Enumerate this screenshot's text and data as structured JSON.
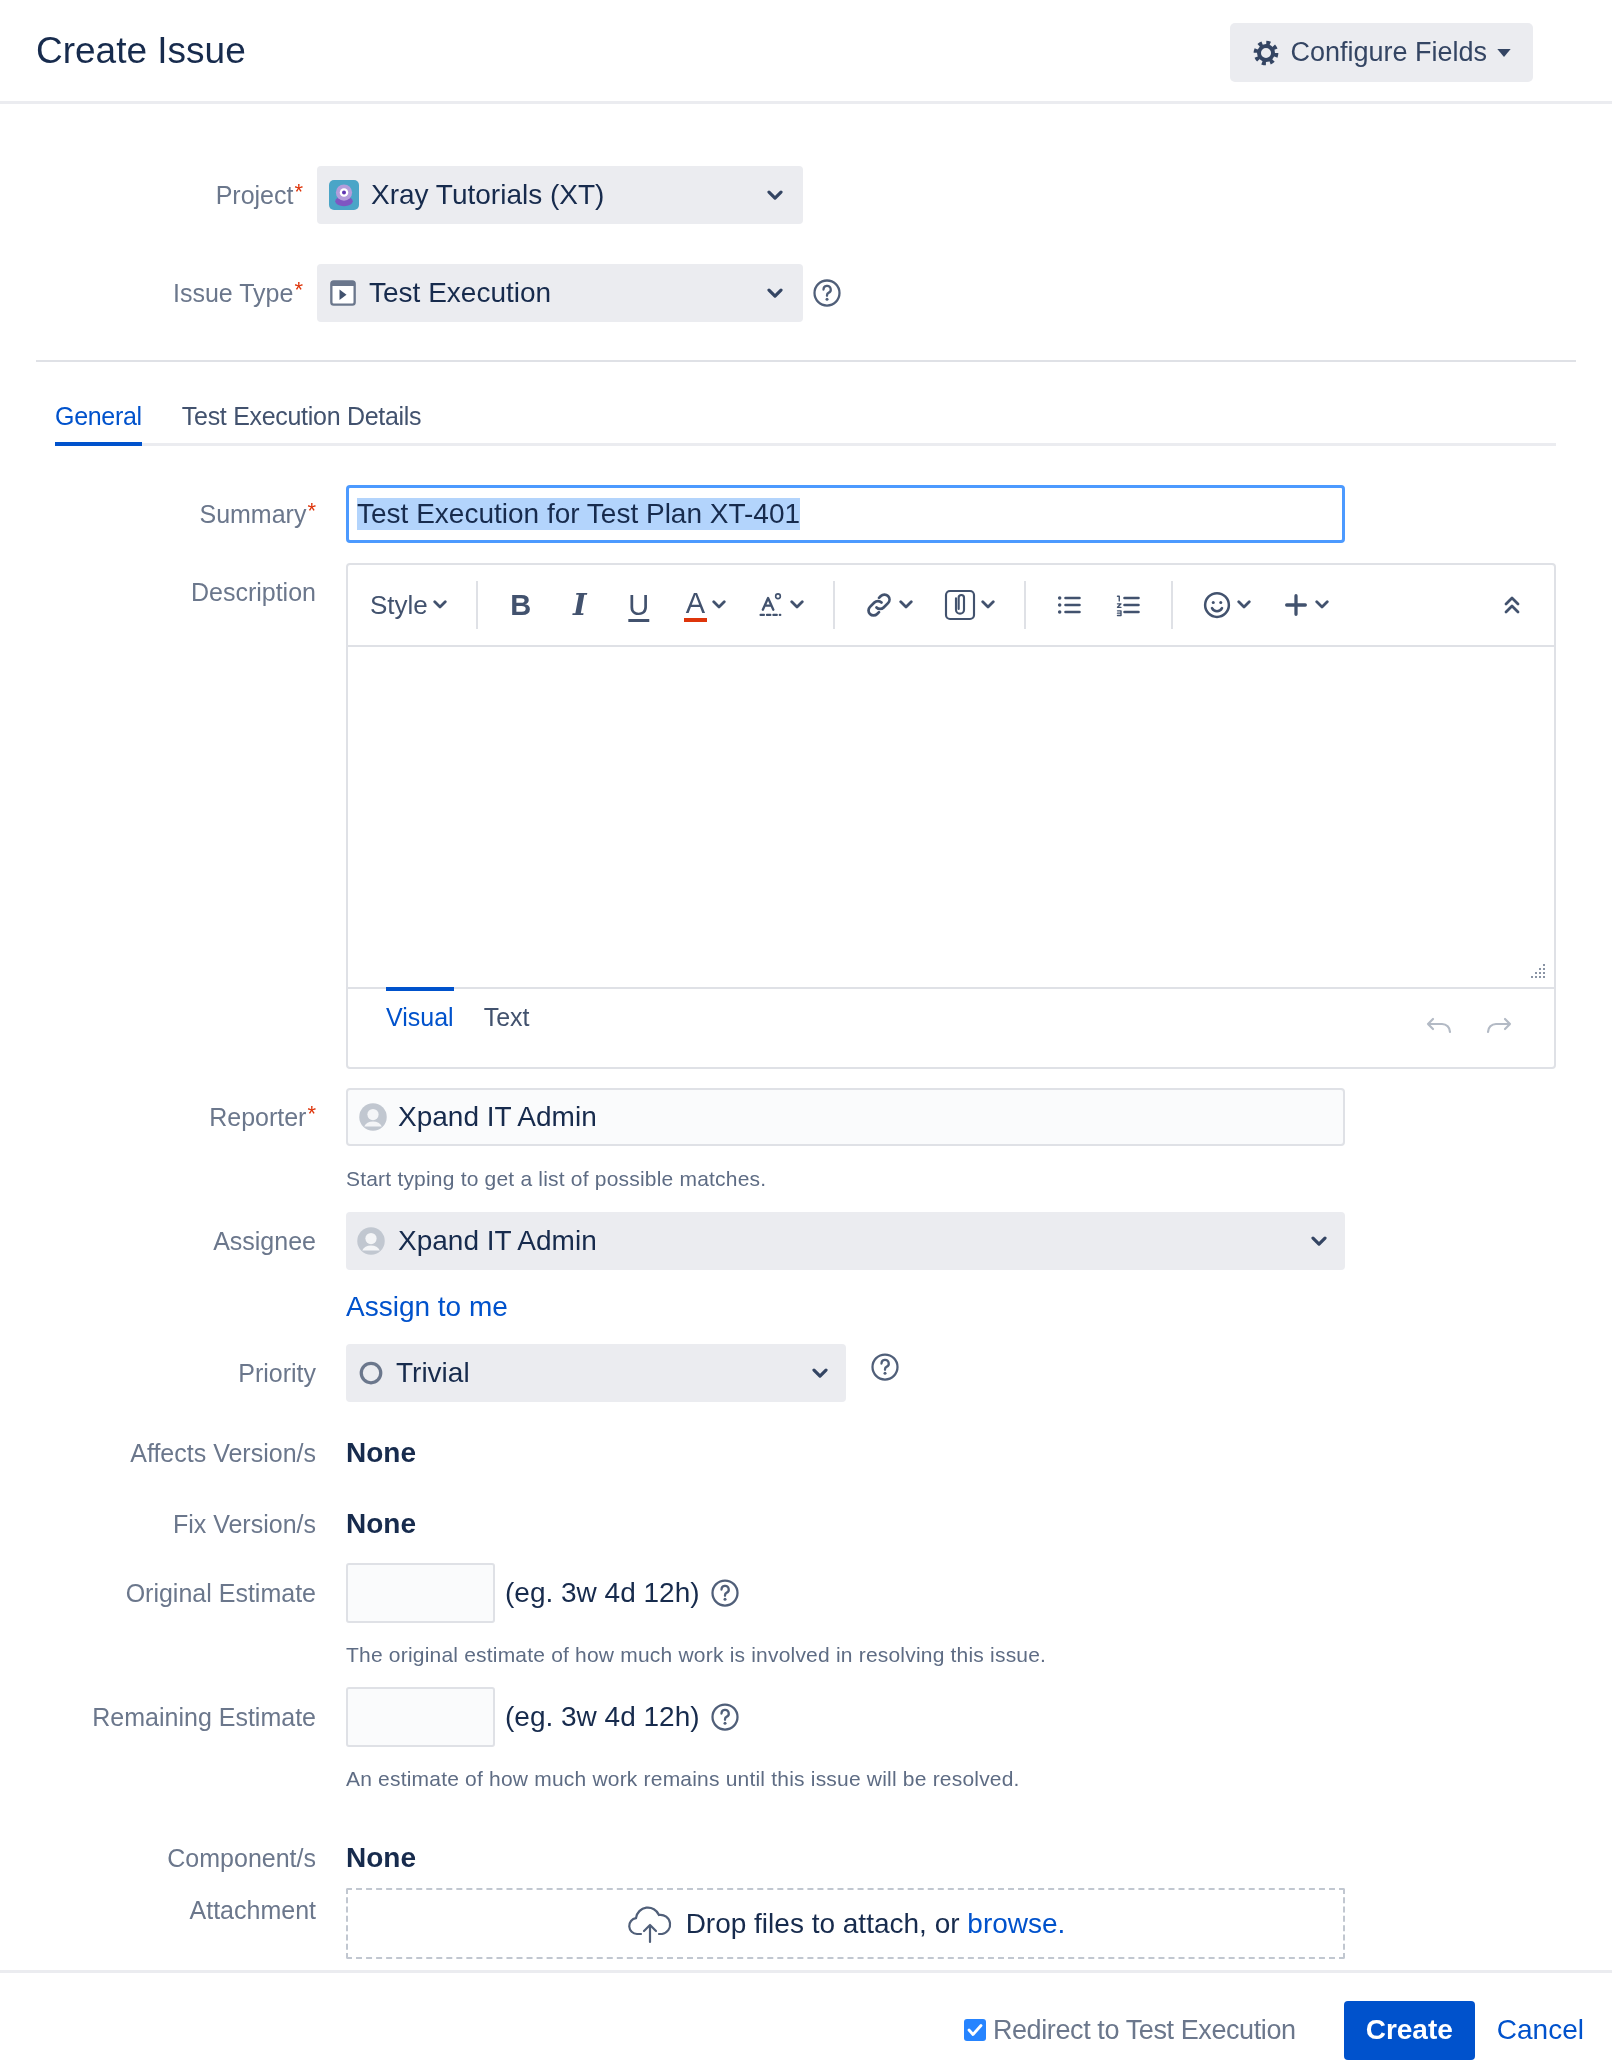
{
  "header": {
    "title": "Create Issue",
    "configure_button": "Configure Fields"
  },
  "top_fields": [
    {
      "label": "Project",
      "required_mark": "*",
      "value": "Xray Tutorials (XT)",
      "help": false
    },
    {
      "label": "Issue Type",
      "required_mark": "*",
      "value": "Test Execution",
      "help": true
    }
  ],
  "tabs": [
    {
      "label": "General",
      "selected": true
    },
    {
      "label": "Test Execution Details",
      "selected": false
    }
  ],
  "fields": [
    {
      "kind": "text",
      "label": "Summary",
      "required_mark": "*",
      "value": "Test Execution for Test Plan XT-401",
      "highlighted": true
    },
    {
      "kind": "editor",
      "label": "Description",
      "toolbar": [
        {
          "kind": "style",
          "label": "Style",
          "dropdown": true
        },
        {
          "kind": "separator"
        },
        {
          "kind": "bold",
          "label": "B",
          "dropdown": false
        },
        {
          "kind": "italic",
          "label": "I",
          "dropdown": false
        },
        {
          "kind": "underline",
          "label": "U",
          "dropdown": false
        },
        {
          "kind": "text-color",
          "label": "A",
          "dropdown": true
        },
        {
          "kind": "text-style",
          "dropdown": true
        },
        {
          "kind": "separator"
        },
        {
          "kind": "link",
          "dropdown": true
        },
        {
          "kind": "attachment",
          "dropdown": true
        },
        {
          "kind": "separator"
        },
        {
          "kind": "bullet-list",
          "dropdown": false
        },
        {
          "kind": "numbered-list",
          "dropdown": false
        },
        {
          "kind": "separator"
        },
        {
          "kind": "emoji",
          "dropdown": true
        },
        {
          "kind": "insert",
          "dropdown": true
        },
        {
          "kind": "collapse",
          "dropdown": false
        }
      ],
      "modes": [
        {
          "label": "Visual",
          "selected": true
        },
        {
          "label": "Text",
          "selected": false
        }
      ],
      "history_enabled": false
    },
    {
      "kind": "user",
      "label": "Reporter",
      "required_mark": "*",
      "value": "Xpand IT Admin",
      "hint": "Start typing to get a list of possible matches."
    },
    {
      "kind": "user-select",
      "label": "Assignee",
      "value": "Xpand IT Admin",
      "link": "Assign to me"
    },
    {
      "kind": "select",
      "label": "Priority",
      "value": "Trivial",
      "help": true
    },
    {
      "kind": "static",
      "label": "Affects Version/s",
      "value": "None"
    },
    {
      "kind": "static",
      "label": "Fix Version/s",
      "value": "None"
    },
    {
      "kind": "estimate",
      "label": "Original Estimate",
      "example": "(eg. 3w 4d 12h)",
      "hint": "The original estimate of how much work is involved in resolving this issue."
    },
    {
      "kind": "estimate",
      "label": "Remaining Estimate",
      "example": "(eg. 3w 4d 12h)",
      "hint": "An estimate of how much work remains until this issue will be resolved."
    },
    {
      "kind": "static",
      "label": "Component/s",
      "value": "None"
    },
    {
      "kind": "attachment",
      "label": "Attachment",
      "text": "Drop files to attach, or",
      "link": "browse."
    }
  ],
  "footer": {
    "redirect": {
      "label": "Redirect to Test Execution",
      "checked": true
    },
    "create_button": "Create",
    "cancel_link": "Cancel"
  }
}
